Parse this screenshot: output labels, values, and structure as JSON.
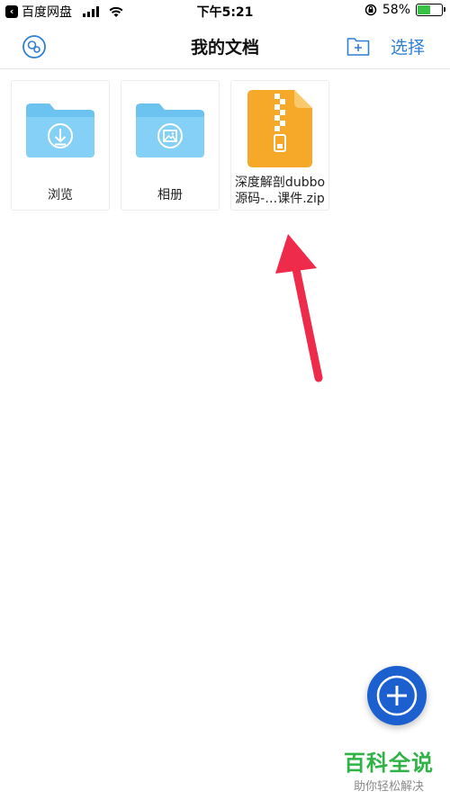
{
  "status_bar": {
    "back_app": "百度网盘",
    "time": "下午5:21",
    "battery": "58%",
    "battery_level": 0.58,
    "battery_color": "#38c346"
  },
  "nav": {
    "title": "我的文档",
    "select_label": "选择",
    "accent_color": "#2f7fd3",
    "icons": [
      "settings-icon",
      "new-folder-icon"
    ]
  },
  "files": [
    {
      "name": "浏览",
      "type": "folder",
      "icon": "download-folder-icon"
    },
    {
      "name": "相册",
      "type": "folder",
      "icon": "image-folder-icon"
    },
    {
      "name_line1": "深度解剖dubbo",
      "name_line2": "源码-…课件.zip",
      "type": "zip",
      "icon": "zip-file-icon"
    }
  ],
  "fab": {
    "icon": "plus-icon",
    "color": "#1c5fcf"
  },
  "watermark": {
    "title": "百科全说",
    "subtitle": "助你轻松解决",
    "color": "#2fb347"
  }
}
